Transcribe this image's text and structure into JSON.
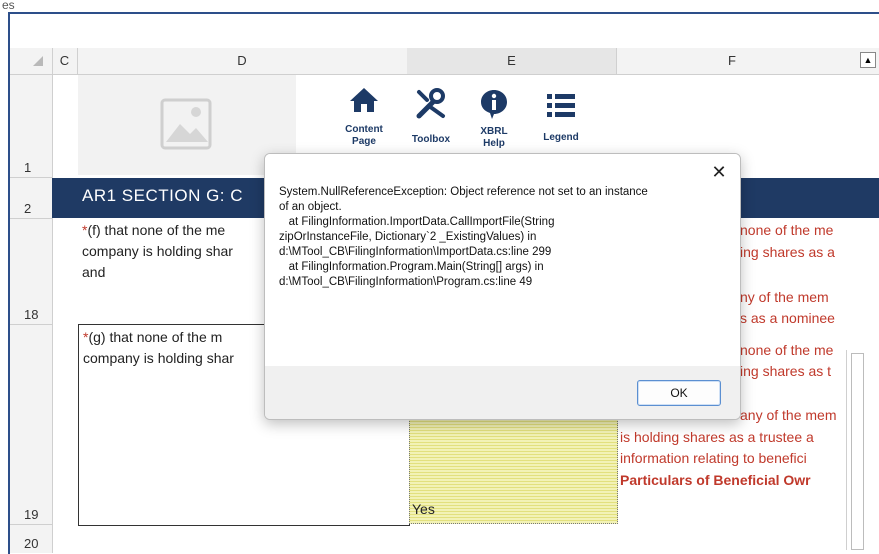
{
  "window": {
    "title": "es"
  },
  "columns": [
    "C",
    "D",
    "E",
    "F"
  ],
  "rows": [
    "1",
    "2",
    "18",
    "19",
    "20"
  ],
  "nav": [
    {
      "label": "Content Page",
      "icon": "home-icon"
    },
    {
      "label": "Toolbox",
      "icon": "tools-icon"
    },
    {
      "label": "XBRL Help",
      "icon": "info-icon"
    },
    {
      "label": "Legend",
      "icon": "list-icon"
    }
  ],
  "section": {
    "title": "AR1  SECTION G: C"
  },
  "cells": {
    "f_label": "*",
    "f_text_1": "(f) that none of the me",
    "f_text_2": "company is holding shar",
    "f_text_3": "and",
    "g_label": "*",
    "g_text_1": "(g) that none of the m",
    "g_text_2": "company is holding shar",
    "yes": "Yes"
  },
  "right_text": [
    "none of the me",
    "ing shares as a",
    "ny of the mem",
    "s as a nominee",
    "none of the me",
    "ing shares as t",
    "any of the mem",
    "is holding shares as a trustee a",
    "information relating to benefici",
    "Particulars of Beneficial Owr"
  ],
  "dialog": {
    "message": "System.NullReferenceException: Object reference not set to an instance\nof an object.\n   at FilingInformation.ImportData.CallImportFile(String\nzipOrInstanceFile, Dictionary`2 _ExistingValues) in\nd:\\MTool_CB\\FilingInformation\\ImportData.cs:line 299\n   at FilingInformation.Program.Main(String[] args) in\nd:\\MTool_CB\\FilingInformation\\Program.cs:line 49",
    "close": "✕",
    "ok": "OK"
  },
  "colors": {
    "banner": "#1f3a64",
    "red_text": "#c0392b",
    "yellow_cell": "#f2f2b6"
  }
}
